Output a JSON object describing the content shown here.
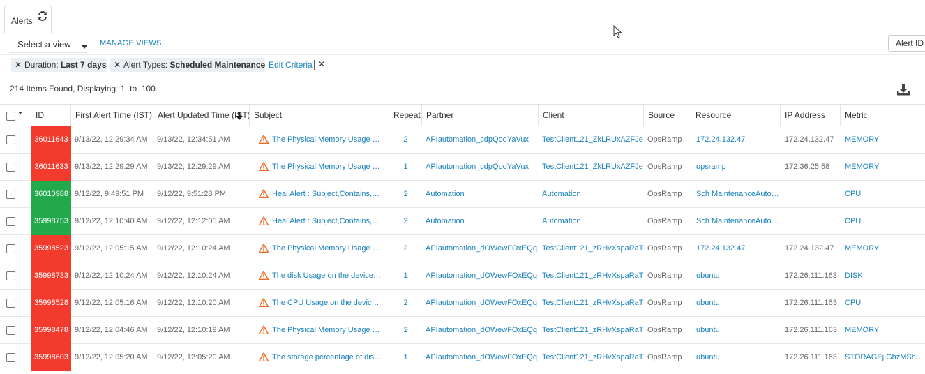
{
  "tab": {
    "label": "Alerts"
  },
  "viewbar": {
    "select_label": "Select a view",
    "manage_views": "MANAGE VIEWS",
    "alert_id_button": "Alert ID"
  },
  "filters": [
    {
      "key": "Duration:",
      "value": "Last 7 days"
    },
    {
      "key": "Alert Types:",
      "value": "Scheduled Maintenance"
    }
  ],
  "edit_criteria": "Edit Criteria",
  "summary": {
    "count": "214",
    "found_text": "Items Found, Displaying",
    "from": "1",
    "to_text": "to",
    "to": "100."
  },
  "colors": {
    "critical": "#f23b2c",
    "ok": "#21a94c",
    "link": "#1a83bd",
    "warning_icon": "#f06b22"
  },
  "columns": [
    "ID",
    "First Alert Time (IST)",
    "Alert Updated Time (IST)",
    "Subject",
    "Repeat",
    "Partner",
    "Client",
    "Source",
    "Resource",
    "IP Address",
    "Metric"
  ],
  "rows": [
    {
      "id": "36011643",
      "status": "critical",
      "first": "9/13/22, 12:29:34 AM",
      "updated": "9/13/22, 12:34:51 AM",
      "subject": "The Physical Memory Usage on the device",
      "repeat": "2",
      "partner": "APIautomation_cdpQooYaVux",
      "client": "TestClient121_ZkLRUxAZFJe",
      "source": "OpsRamp",
      "resource": "172.24.132.47",
      "ip": "172.24.132.47",
      "metric": "MEMORY"
    },
    {
      "id": "36011633",
      "status": "critical",
      "first": "9/13/22, 12:29:29 AM",
      "updated": "9/13/22, 12:29:29 AM",
      "subject": "The Physical Memory Usage on the device",
      "repeat": "1",
      "partner": "APIautomation_cdpQooYaVux",
      "client": "TestClient121_ZkLRUxAZFJe",
      "source": "OpsRamp",
      "resource": "opsramp",
      "ip": "172.36.25.58",
      "metric": "MEMORY"
    },
    {
      "id": "36010988",
      "status": "ok",
      "first": "9/12/22, 9:49:51 PM",
      "updated": "9/12/22, 9:51:28 PM",
      "subject": "Heal Alert : Subject,Contains,Scheduled",
      "repeat": "2",
      "partner": "Automation",
      "client": "Automation",
      "source": "OpsRamp",
      "resource": "Sch MaintenanceAutomation",
      "ip": "",
      "metric": "CPU"
    },
    {
      "id": "35998753",
      "status": "ok",
      "first": "9/12/22, 12:10:40 AM",
      "updated": "9/12/22, 12:12:05 AM",
      "subject": "Heal Alert : Subject,Contains,Scheduled",
      "repeat": "2",
      "partner": "Automation",
      "client": "Automation",
      "source": "OpsRamp",
      "resource": "Sch MaintenanceAutomation",
      "ip": "",
      "metric": "CPU"
    },
    {
      "id": "35998523",
      "status": "critical",
      "first": "9/12/22, 12:05:15 AM",
      "updated": "9/12/22, 12:10:24 AM",
      "subject": "The Physical Memory Usage on the device",
      "repeat": "2",
      "partner": "APIautomation_dOWewFOxEQq",
      "client": "TestClient121_zRHvXspaRaT",
      "source": "OpsRamp",
      "resource": "172.24.132.47",
      "ip": "172.24.132.47",
      "metric": "MEMORY"
    },
    {
      "id": "35998733",
      "status": "critical",
      "first": "9/12/22, 12:10:24 AM",
      "updated": "9/12/22, 12:10:24 AM",
      "subject": "The disk Usage on the device is high",
      "repeat": "1",
      "partner": "APIautomation_dOWewFOxEQq",
      "client": "TestClient121_zRHvXspaRaT",
      "source": "OpsRamp",
      "resource": "ubuntu",
      "ip": "172.26.111.163",
      "metric": "DISK"
    },
    {
      "id": "35998528",
      "status": "critical",
      "first": "9/12/22, 12:05:16 AM",
      "updated": "9/12/22, 12:10:20 AM",
      "subject": "The CPU Usage on the device is high",
      "repeat": "2",
      "partner": "APIautomation_dOWewFOxEQq",
      "client": "TestClient121_zRHvXspaRaT",
      "source": "OpsRamp",
      "resource": "ubuntu",
      "ip": "172.26.111.163",
      "metric": "CPU"
    },
    {
      "id": "35998478",
      "status": "critical",
      "first": "9/12/22, 12:04:46 AM",
      "updated": "9/12/22, 12:10:19 AM",
      "subject": "The Physical Memory Usage on the device",
      "repeat": "2",
      "partner": "APIautomation_dOWewFOxEQq",
      "client": "TestClient121_zRHvXspaRaT",
      "source": "OpsRamp",
      "resource": "ubuntu",
      "ip": "172.26.111.163",
      "metric": "MEMORY"
    },
    {
      "id": "35998603",
      "status": "critical",
      "first": "9/12/22, 12:05:20 AM",
      "updated": "9/12/22, 12:05:20 AM",
      "subject": "The storage percentage of disk is high",
      "repeat": "1",
      "partner": "APIautomation_dOWewFOxEQq",
      "client": "TestClient121_zRHvXspaRaT",
      "source": "OpsRamp",
      "resource": "ubuntu",
      "ip": "172.26.111.163",
      "metric": "STORAGEjIGhzMShAnd"
    }
  ]
}
